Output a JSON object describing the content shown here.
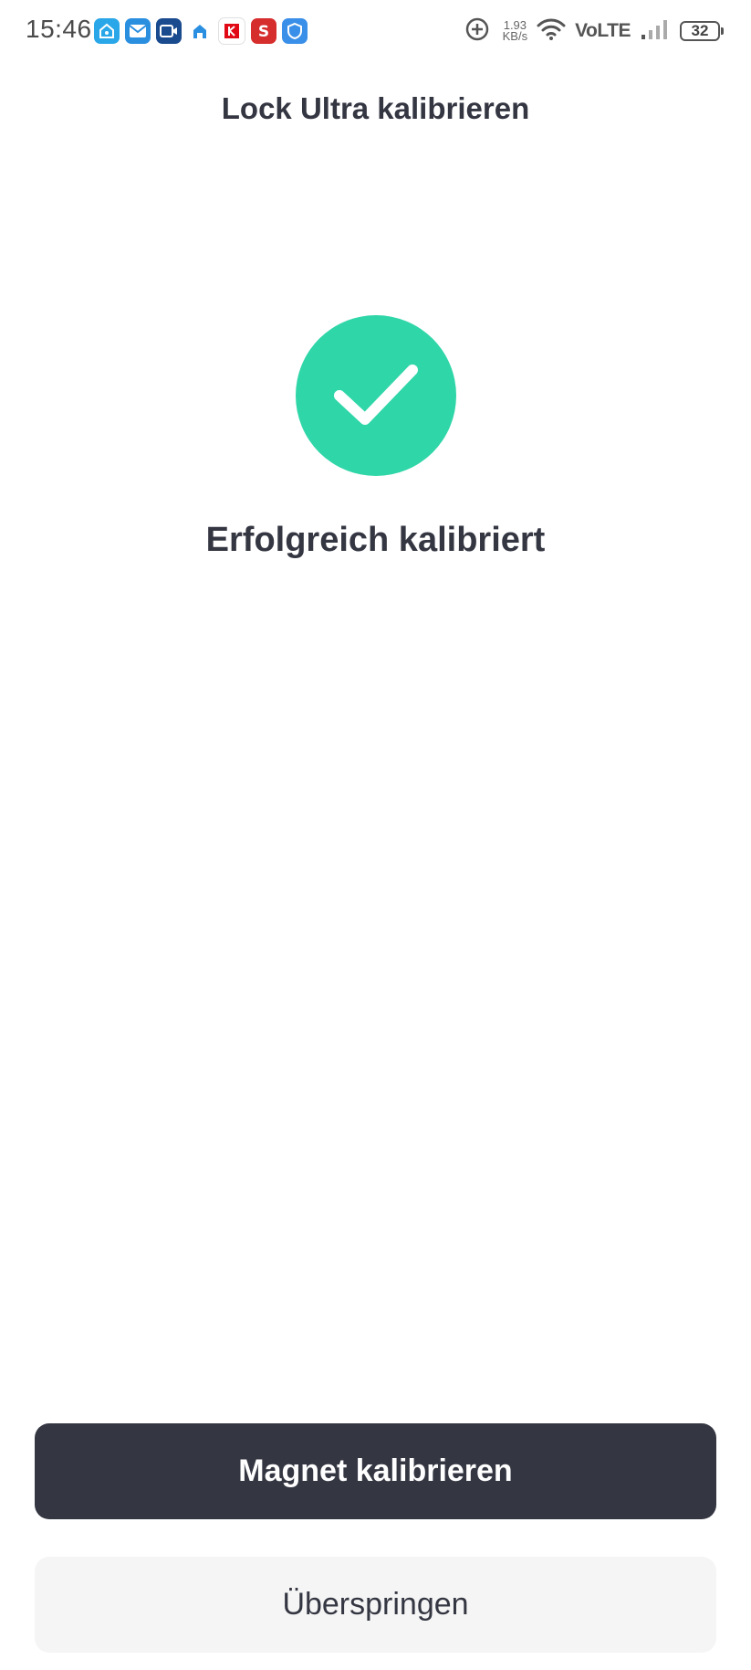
{
  "status_bar": {
    "time": "15:46",
    "notification_icons": [
      "home-assistant-icon",
      "mail-icon",
      "video-call-icon",
      "smart-home-icon",
      "kaufland-icon",
      "s-app-icon",
      "shield-app-icon"
    ],
    "network_speed_value": "1.93",
    "network_speed_unit": "KB/s",
    "volte": "VoLTE",
    "battery_level": "32"
  },
  "header": {
    "title": "Lock Ultra kalibrieren"
  },
  "status": {
    "message": "Erfolgreich kalibriert",
    "icon": "check-icon",
    "color": "#2fd6a8"
  },
  "actions": {
    "primary_label": "Magnet kalibrieren",
    "secondary_label": "Überspringen"
  },
  "colors": {
    "primary_button": "#343642",
    "secondary_button": "#f5f5f5",
    "success": "#2fd6a8"
  }
}
